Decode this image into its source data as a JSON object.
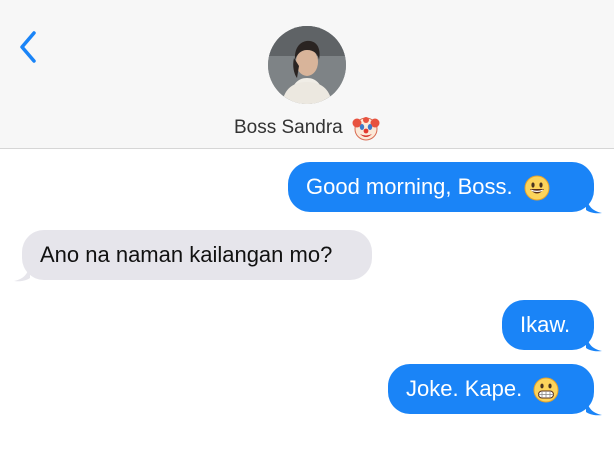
{
  "header": {
    "back_icon": "chevron-left-icon",
    "contact_name": "Boss Sandra",
    "contact_emoji": "clown-face-icon"
  },
  "messages": [
    {
      "direction": "outgoing",
      "text": "Good morning, Boss.",
      "emoji": "grinning-face-icon"
    },
    {
      "direction": "incoming",
      "text": "Ano na naman kailangan mo?"
    },
    {
      "direction": "outgoing",
      "text": "Ikaw."
    },
    {
      "direction": "outgoing",
      "text": "Joke. Kape.",
      "emoji": "grimacing-face-icon"
    }
  ],
  "colors": {
    "outgoing_bubble": "#1a84f7",
    "incoming_bubble": "#e6e5eb",
    "accent": "#1a84f7",
    "header_bg": "#f7f7f7"
  }
}
